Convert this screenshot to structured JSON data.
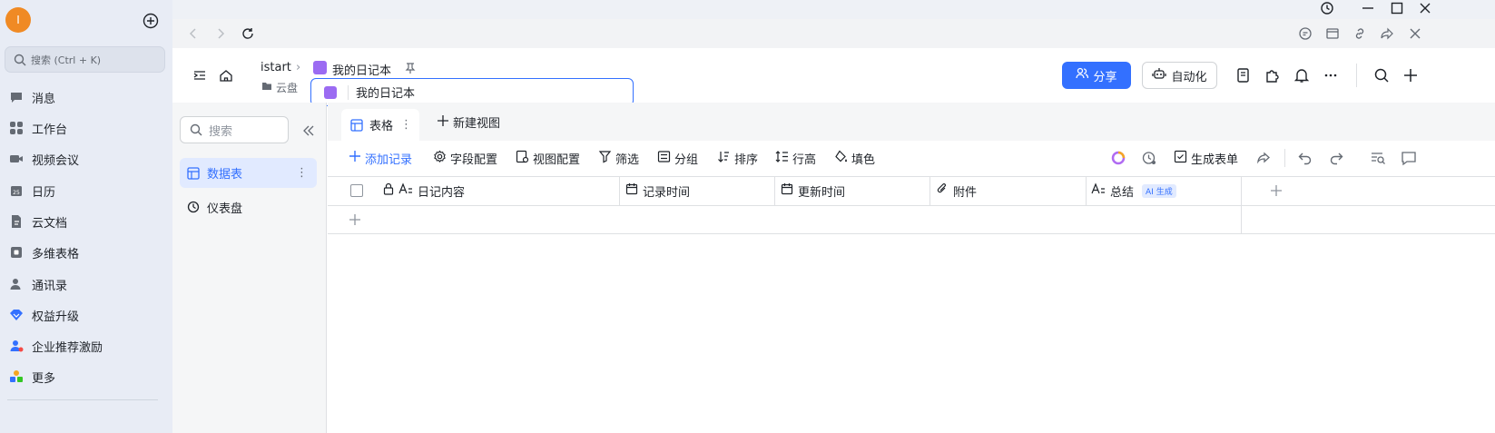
{
  "app": {
    "avatar_initial": "I",
    "search_placeholder": "搜索 (Ctrl + K)",
    "nav": [
      {
        "label": "消息",
        "icon": "chat-bubble-icon"
      },
      {
        "label": "工作台",
        "icon": "grid-apps-icon"
      },
      {
        "label": "视频会议",
        "icon": "video-camera-icon"
      },
      {
        "label": "日历",
        "icon": "calendar-icon"
      },
      {
        "label": "云文档",
        "icon": "cloud-document-icon"
      },
      {
        "label": "多维表格",
        "icon": "base-table-icon"
      },
      {
        "label": "通讯录",
        "icon": "contacts-icon"
      },
      {
        "label": "权益升级",
        "icon": "diamond-upgrade-icon"
      },
      {
        "label": "企业推荐激励",
        "icon": "referral-person-icon"
      },
      {
        "label": "更多",
        "icon": "more-apps-icon"
      }
    ]
  },
  "document": {
    "breadcrumb_root": "istart",
    "title": "我的日记本",
    "folder": "云盘",
    "rename_value": "我的日记本"
  },
  "header": {
    "share_label": "分享",
    "automation_label": "自动化"
  },
  "tables": {
    "search_placeholder": "搜索",
    "items": [
      {
        "label": "数据表",
        "active": true
      },
      {
        "label": "仪表盘",
        "active": false
      }
    ]
  },
  "views": {
    "tabs": [
      {
        "label": "表格"
      }
    ],
    "new_view_label": "新建视图"
  },
  "toolbar": {
    "add_record": "添加记录",
    "field_config": "字段配置",
    "view_config": "视图配置",
    "filter": "筛选",
    "group": "分组",
    "sort": "排序",
    "row_height": "行高",
    "fill_color": "填色",
    "generate_form": "生成表单"
  },
  "grid": {
    "columns": [
      {
        "label": "日记内容",
        "type": "text"
      },
      {
        "label": "记录时间",
        "type": "date"
      },
      {
        "label": "更新时间",
        "type": "date"
      },
      {
        "label": "附件",
        "type": "attachment"
      },
      {
        "label": "总结",
        "type": "text",
        "badge": "AI 生成"
      }
    ]
  },
  "colors": {
    "accent": "#3370ff",
    "avatar": "#f08a24",
    "doc_icon": "#9b6bf2"
  }
}
